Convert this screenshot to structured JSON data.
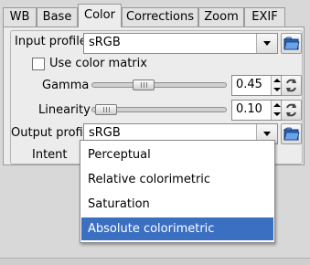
{
  "tabs": [
    {
      "label": "WB"
    },
    {
      "label": "Base"
    },
    {
      "label": "Color"
    },
    {
      "label": "Corrections"
    },
    {
      "label": "Zoom"
    },
    {
      "label": "EXIF"
    }
  ],
  "active_tab": "Color",
  "input_profile": {
    "label": "Input profile",
    "value": "sRGB",
    "icon": "folder-open-icon"
  },
  "use_color_matrix": {
    "label": "Use color matrix",
    "checked": false
  },
  "gamma": {
    "label": "Gamma",
    "value": "0.45",
    "slider_fraction": 0.33,
    "reset_icon": "reset-icon"
  },
  "linearity": {
    "label": "Linearity",
    "value": "0.10",
    "slider_fraction": 0.05,
    "reset_icon": "reset-icon"
  },
  "output_profile": {
    "label": "Output profile",
    "value": "sRGB",
    "icon": "folder-open-icon"
  },
  "intent": {
    "label": "Intent",
    "options": [
      "Perceptual",
      "Relative colorimetric",
      "Saturation",
      "Absolute colorimetric"
    ],
    "selected": "Absolute colorimetric"
  },
  "colors": {
    "selection": "#3a6fc2",
    "panel_bg": "#ececec"
  }
}
